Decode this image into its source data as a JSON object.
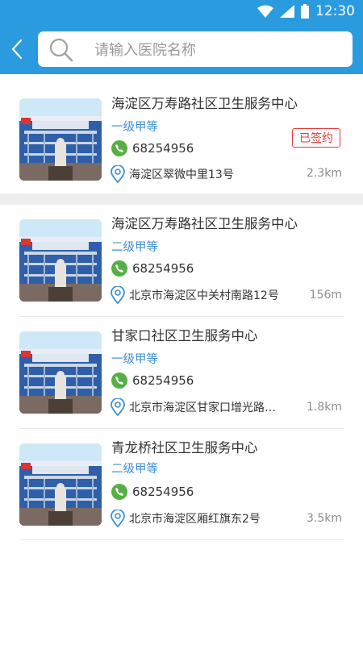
{
  "status": {
    "time": "12:30"
  },
  "search": {
    "placeholder": "请输入医院名称"
  },
  "signed_badge": "已签约",
  "hospitals": [
    {
      "name": "海淀区万寿路社区卫生服务中心",
      "level": "一级甲等",
      "phone": "68254956",
      "address": "海淀区翠微中里13号",
      "distance": "2.3km"
    },
    {
      "name": "海淀区万寿路社区卫生服务中心",
      "level": "二级甲等",
      "phone": "68254956",
      "address": "北京市海淀区中关村南路12号",
      "distance": "156m"
    },
    {
      "name": "甘家口社区卫生服务中心",
      "level": "一级甲等",
      "phone": "68254956",
      "address": "北京市海淀区甘家口增光路…",
      "distance": "1.8km"
    },
    {
      "name": "青龙桥社区卫生服务中心",
      "level": "二级甲等",
      "phone": "68254956",
      "address": "北京市海淀区厢红旗东2号",
      "distance": "3.5km"
    }
  ]
}
